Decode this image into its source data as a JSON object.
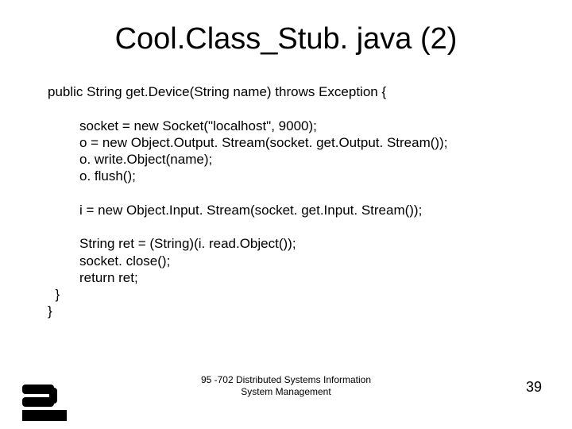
{
  "title": "Cool.Class_Stub. java (2)",
  "code": {
    "l1": "public String get.Device(String name) throws Exception {",
    "l2": "socket = new Socket(\"localhost\", 9000);",
    "l3": "o = new Object.Output. Stream(socket. get.Output. Stream());",
    "l4": "o. write.Object(name);",
    "l5": "o. flush();",
    "l6": "i = new Object.Input. Stream(socket. get.Input. Stream());",
    "l7": "String ret = (String)(i. read.Object());",
    "l8": "socket. close();",
    "l9": "return ret;",
    "l10": "  }",
    "l11": "}"
  },
  "footer": {
    "line1": "95 -702 Distributed Systems Information",
    "line2": "System Management"
  },
  "page_number": "39"
}
